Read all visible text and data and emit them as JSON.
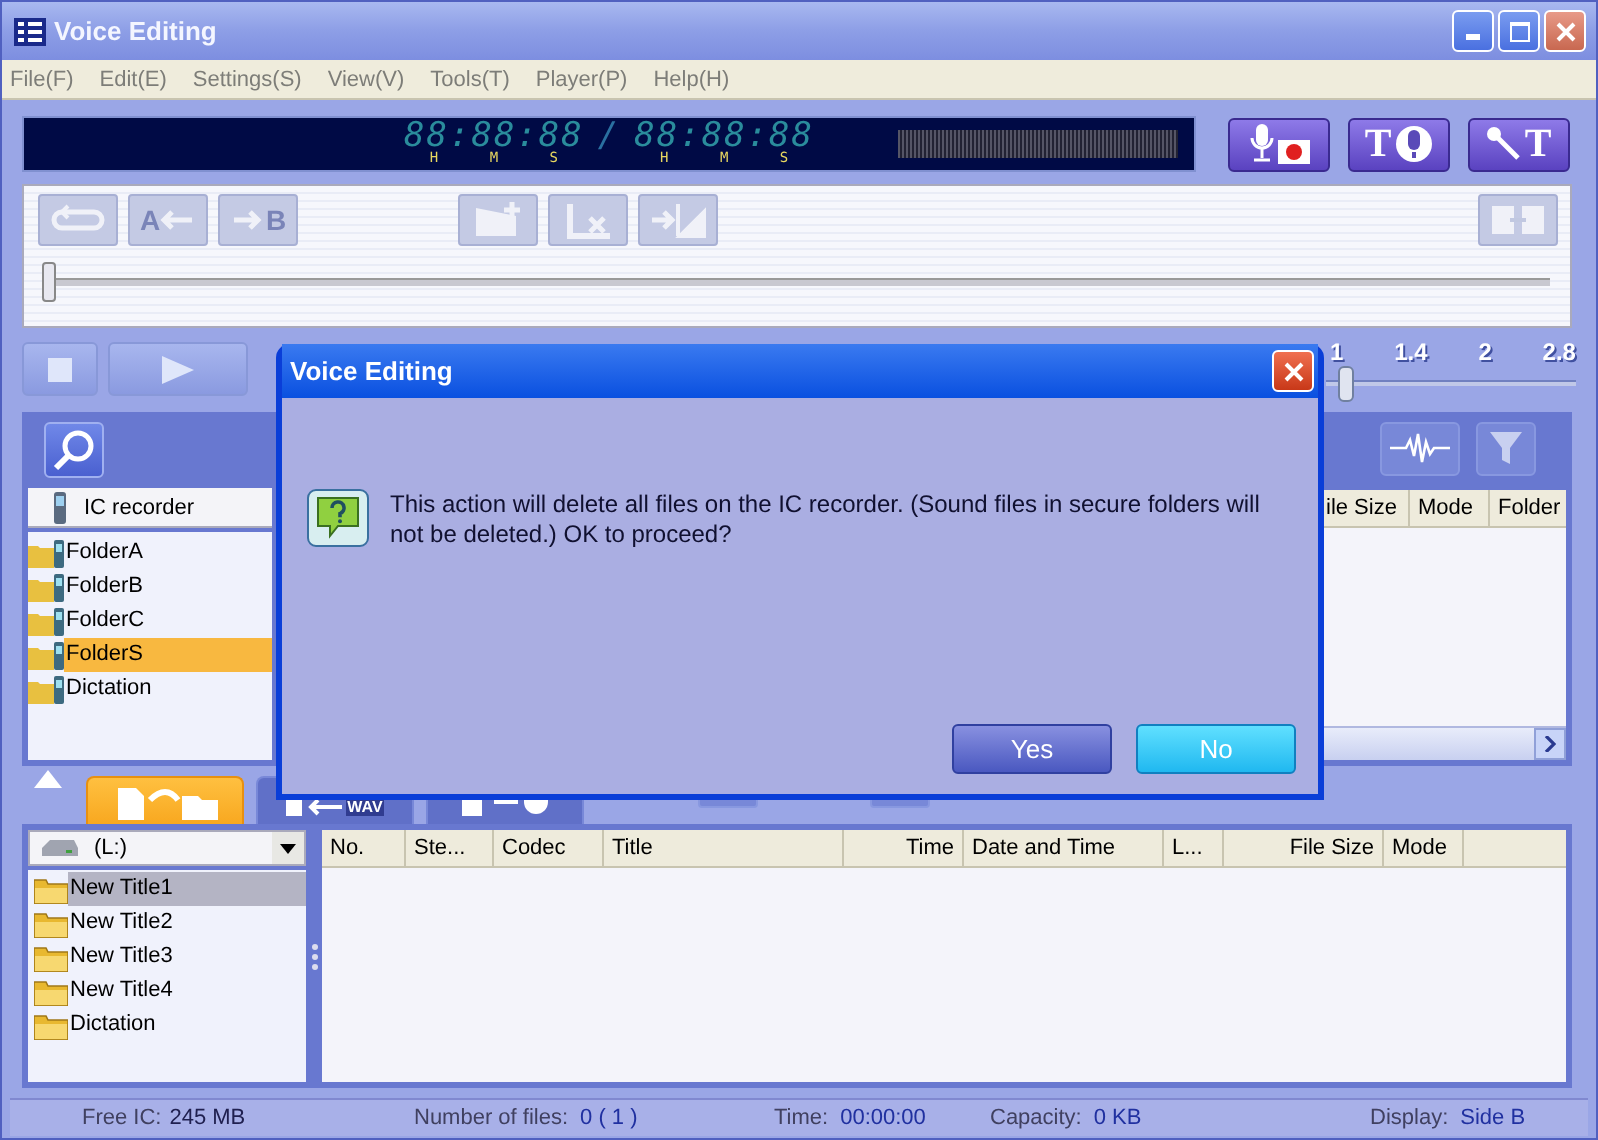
{
  "window": {
    "title": "Voice Editing"
  },
  "menu": [
    "File(F)",
    "Edit(E)",
    "Settings(S)",
    "View(V)",
    "Tools(T)",
    "Player(P)",
    "Help(H)"
  ],
  "display": {
    "elapsed": "88:88:88",
    "elapsed_units": [
      "H",
      "M",
      "S"
    ],
    "separator": "/",
    "total": "88:88:88",
    "total_units": [
      "H",
      "M",
      "S"
    ]
  },
  "mode_buttons": [
    {
      "kind": "record"
    },
    {
      "kind": "text_to_voice",
      "letter": "T"
    },
    {
      "kind": "voice_to_text",
      "letter": "T"
    }
  ],
  "edit_toolbar": {
    "buttons": [
      {
        "kind": "repeat",
        "disabled": true
      },
      {
        "kind": "a_point",
        "letter": "A",
        "disabled": true
      },
      {
        "kind": "b_point",
        "letter": "B",
        "disabled": true
      },
      {
        "kind": "mark_add",
        "disabled": true
      },
      {
        "kind": "mark_delete",
        "disabled": true
      },
      {
        "kind": "divide",
        "disabled": true
      },
      {
        "kind": "combine",
        "disabled": true
      }
    ],
    "level": 0
  },
  "transport": [
    {
      "kind": "stop"
    },
    {
      "kind": "play"
    }
  ],
  "speed": {
    "ticks": [
      "1",
      "1.4",
      "2",
      "2.8"
    ],
    "level": 0.05
  },
  "ic_panel": {
    "source": "IC recorder",
    "folders": [
      {
        "name": "FolderA",
        "selected": false
      },
      {
        "name": "FolderB",
        "selected": false
      },
      {
        "name": "FolderC",
        "selected": false
      },
      {
        "name": "FolderS",
        "selected": true
      },
      {
        "name": "Dictation",
        "selected": false
      }
    ],
    "tools": [
      {
        "kind": "waveform"
      },
      {
        "kind": "filter"
      }
    ],
    "columns": [
      "ile Size",
      "Mode",
      "Folder"
    ]
  },
  "pc_panel": {
    "tabs": [
      {
        "kind": "copy",
        "selected": true
      },
      {
        "kind": "convert",
        "label": "WAV",
        "selected": false
      },
      {
        "kind": "disc",
        "selected": false
      }
    ],
    "drive": "(L:)",
    "folders": [
      {
        "name": "New Title1",
        "selected": true
      },
      {
        "name": "New Title2",
        "selected": false
      },
      {
        "name": "New Title3",
        "selected": false
      },
      {
        "name": "New Title4",
        "selected": false
      },
      {
        "name": "Dictation",
        "selected": false
      }
    ],
    "columns": [
      "No.",
      "Ste...",
      "Codec",
      "Title",
      "Time",
      "Date and Time",
      "L...",
      "File Size",
      "Mode"
    ]
  },
  "status": [
    {
      "label": "Free IC:",
      "value": "245 MB"
    },
    {
      "label": "Number of files:",
      "value": "0 ( 1 )"
    },
    {
      "label": "Time:",
      "value": "00:00:00"
    },
    {
      "label": "Capacity:",
      "value": "0 KB"
    },
    {
      "label": "Display:",
      "value": "Side B"
    }
  ],
  "dialog": {
    "title": "Voice Editing",
    "message": "This action will delete all files on the IC recorder. (Sound files in secure folders will not be deleted.)  OK to proceed?",
    "buttons": [
      {
        "label": "Yes",
        "focused": false
      },
      {
        "label": "No",
        "focused": true
      }
    ]
  }
}
